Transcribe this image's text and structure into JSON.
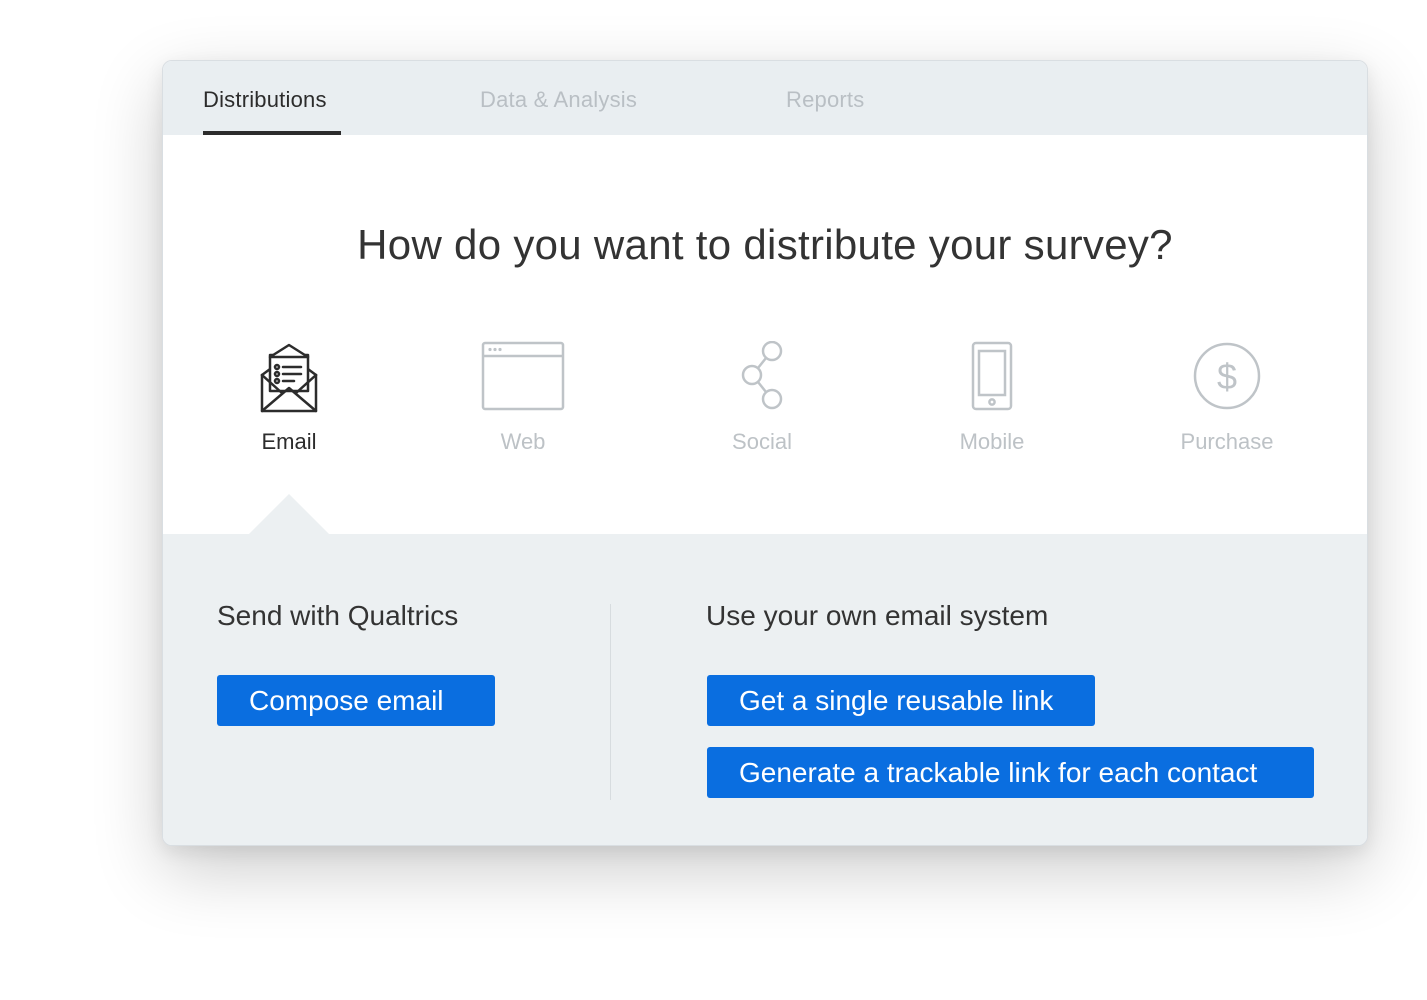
{
  "tabs": [
    {
      "label": "Distributions",
      "active": true
    },
    {
      "label": "Data & Analysis",
      "active": false
    },
    {
      "label": "Reports",
      "active": false
    }
  ],
  "question": "How do you want to distribute your survey?",
  "channels": [
    {
      "label": "Email",
      "icon": "envelope-icon",
      "active": true
    },
    {
      "label": "Web",
      "icon": "browser-window-icon",
      "active": false
    },
    {
      "label": "Social",
      "icon": "share-nodes-icon",
      "active": false
    },
    {
      "label": "Mobile",
      "icon": "mobile-phone-icon",
      "active": false
    },
    {
      "label": "Purchase",
      "icon": "dollar-circle-icon",
      "active": false
    }
  ],
  "panel": {
    "left_title": "Send with Qualtrics",
    "compose_button": "Compose email",
    "right_title": "Use your own email system",
    "reusable_link_button": "Get a single reusable link",
    "trackable_link_button": "Generate a trackable link for each contact"
  },
  "colors": {
    "accent": "#0a6ee0",
    "tab_bar": "#e9eef1",
    "panel": "#ecf0f2",
    "active_text": "#2c2c2c",
    "inactive_text": "#bdc2c6"
  }
}
